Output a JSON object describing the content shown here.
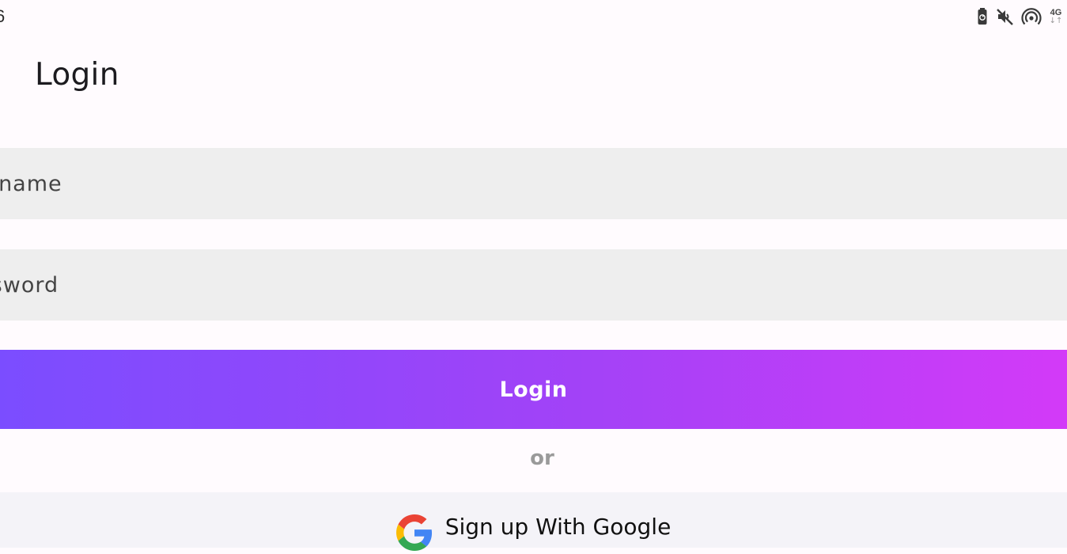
{
  "status_bar": {
    "time": "6",
    "network_label": "4G",
    "network_arrows": "↓↑",
    "icons": [
      "battery-saver-icon",
      "mute-icon",
      "hotspot-icon",
      "network-4g-icon"
    ]
  },
  "page": {
    "title": "Login"
  },
  "form": {
    "username_placeholder": "Username",
    "password_placeholder": "Password",
    "login_label": "Login",
    "divider_text": "or",
    "google_label": "Sign up With Google"
  },
  "colors": {
    "gradient_start": "#7b4dff",
    "gradient_end": "#d33af8",
    "field_background": "#eeeeee",
    "page_background": "#fffbfe"
  }
}
